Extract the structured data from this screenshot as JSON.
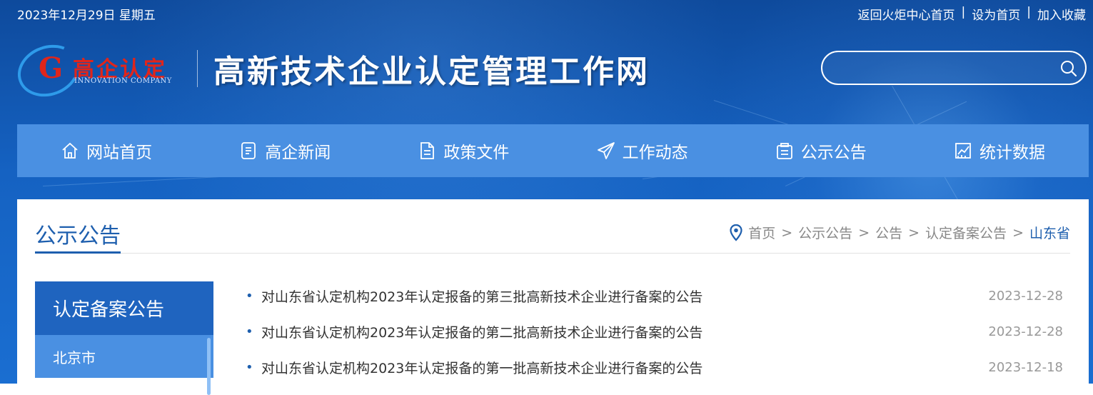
{
  "topbar": {
    "date": "2023年12月29日 星期五",
    "links": [
      "返回火炬中心首页",
      "设为首页",
      "加入收藏"
    ],
    "separator": "|"
  },
  "logo": {
    "mark": "G",
    "name_cn": "高企认定",
    "name_en": "INNOVATION COMPANY"
  },
  "site_title": "高新技术企业认定管理工作网",
  "search": {
    "placeholder": "",
    "icon": "search-icon"
  },
  "nav": [
    {
      "label": "网站首页",
      "icon": "home-icon"
    },
    {
      "label": "高企新闻",
      "icon": "news-icon"
    },
    {
      "label": "政策文件",
      "icon": "document-icon"
    },
    {
      "label": "工作动态",
      "icon": "paper-plane-icon"
    },
    {
      "label": "公示公告",
      "icon": "announcement-icon"
    },
    {
      "label": "统计数据",
      "icon": "chart-icon"
    }
  ],
  "section": {
    "title": "公示公告"
  },
  "breadcrumb": {
    "items": [
      "首页",
      "公示公告",
      "公告",
      "认定备案公告",
      "山东省"
    ],
    "separator": ">"
  },
  "sidebar": {
    "title": "认定备案公告",
    "items": [
      "北京市"
    ]
  },
  "list": [
    {
      "title": "对山东省认定机构2023年认定报备的第三批高新技术企业进行备案的公告",
      "date": "2023-12-28"
    },
    {
      "title": "对山东省认定机构2023年认定报备的第二批高新技术企业进行备案的公告",
      "date": "2023-12-28"
    },
    {
      "title": "对山东省认定机构2023年认定报备的第一批高新技术企业进行备案的公告",
      "date": "2023-12-18"
    }
  ],
  "colors": {
    "header_bg": "#1562c2",
    "nav_bg": "#4a90e2",
    "accent": "#1e5fae",
    "logo_red": "#e0251b"
  }
}
